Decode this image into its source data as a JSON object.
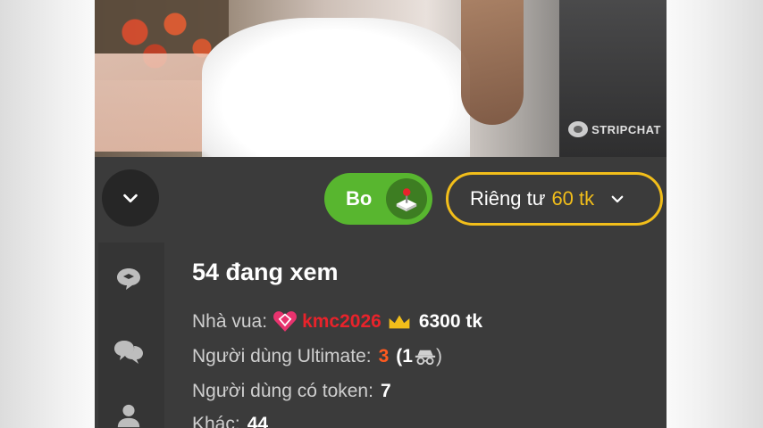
{
  "video": {
    "watermark": "STRIPCHAT"
  },
  "controls": {
    "bo_label": "Bo",
    "private_label": "Riêng tư",
    "private_price": "60 tk"
  },
  "info": {
    "viewers": "54 đang xem",
    "king_label": "Nhà vua:",
    "king_name": "kmc2026",
    "king_tokens": "6300 tk",
    "ultimate_label": "Người dùng Ultimate:",
    "ultimate_count": "3",
    "ultimate_open": "(1",
    "ultimate_close": ")",
    "token_users_label": "Người dùng có token:",
    "token_users_count": "7",
    "other_label": "Khác:",
    "other_count": "44"
  },
  "icons": {
    "collapse": "chevron-down-icon",
    "joystick": "joystick-icon",
    "private_chevron": "chevron-down-icon",
    "rail": [
      "chat-bubble-icon",
      "group-chat-icon",
      "user-icon"
    ],
    "king_badge": "heart-diamond-icon",
    "crown": "crown-icon",
    "incognito": "incognito-icon"
  },
  "colors": {
    "panel_bg": "#3b3b3b",
    "bo_green": "#58b62f",
    "private_gold": "#f2be1a",
    "king_red": "#e8232b",
    "ultimate_orange": "#ff5a1f"
  }
}
